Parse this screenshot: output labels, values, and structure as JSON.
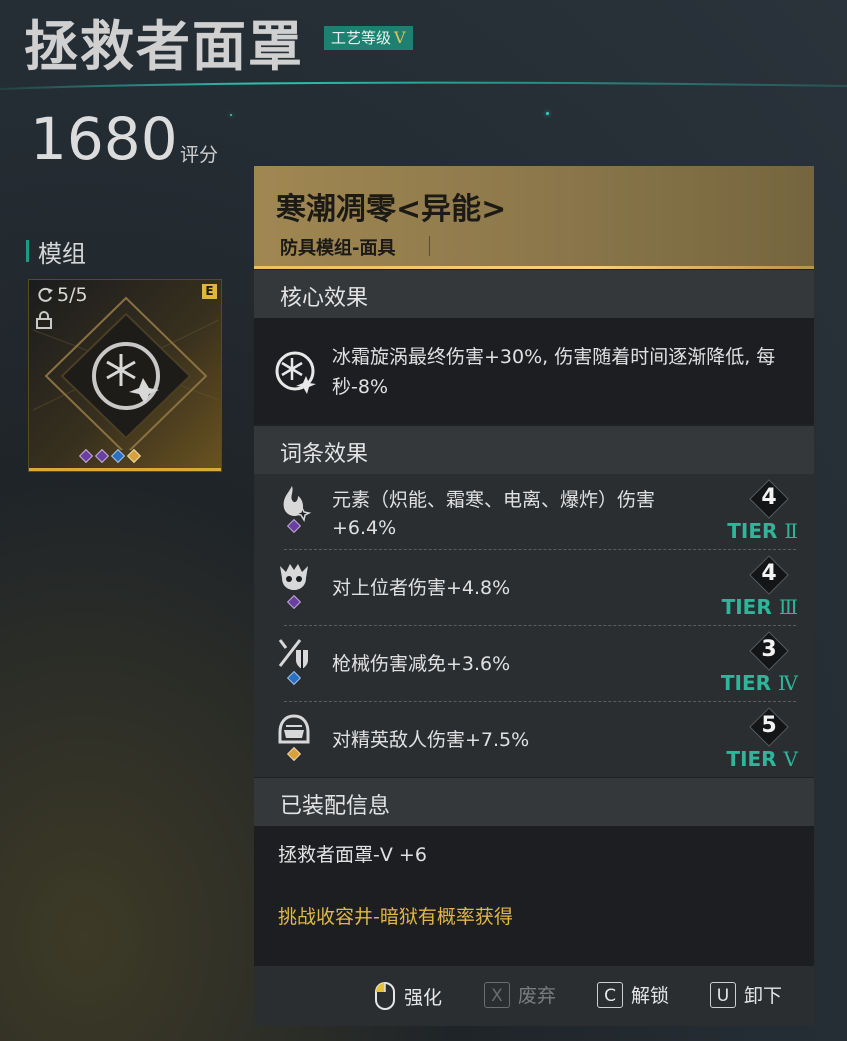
{
  "header": {
    "title": "拯救者面罩",
    "craft_label": "工艺等级",
    "craft_level": "V",
    "score_value": "1680",
    "score_unit": "评分"
  },
  "module_section": {
    "label": "模组",
    "card": {
      "count": "5/5",
      "rarity_badge": "E",
      "gems": [
        "#6b3fa0",
        "#6b3fa0",
        "#2a6fc0",
        "#d8a23a"
      ]
    }
  },
  "panel": {
    "item_name": "寒潮凋零<异能>",
    "item_type": "防具模组-面具",
    "core_header": "核心效果",
    "core_effect": "冰霜旋涡最终伤害+30%, 伤害随着时间逐渐降低, 每秒-8%",
    "affix_header": "词条效果",
    "affixes": [
      {
        "text": "元素（炽能、霜寒、电离、爆炸）伤害+6.4%",
        "rank": "4",
        "tier_prefix": "TIER",
        "tier_roman": "Ⅱ",
        "gem_color": "#6b3fa0",
        "icon": "element-flame-icon"
      },
      {
        "text": "对上位者伤害+4.8%",
        "rank": "4",
        "tier_prefix": "TIER",
        "tier_roman": "Ⅲ",
        "gem_color": "#6b3fa0",
        "icon": "boss-skull-icon"
      },
      {
        "text": "枪械伤害减免+3.6%",
        "rank": "3",
        "tier_prefix": "TIER",
        "tier_roman": "Ⅳ",
        "gem_color": "#2a6fc0",
        "icon": "gun-shield-icon"
      },
      {
        "text": "对精英敌人伤害+7.5%",
        "rank": "5",
        "tier_prefix": "TIER",
        "tier_roman": "Ⅴ",
        "gem_color": "#d8a23a",
        "icon": "elite-helmet-icon"
      }
    ],
    "equip_header": "已装配信息",
    "equip_name": "拯救者面罩-V +6",
    "equip_source": "挑战收容井-暗狱有概率获得"
  },
  "actions": [
    {
      "key": "mouse",
      "label": "强化",
      "enabled": true
    },
    {
      "key": "X",
      "label": "废弃",
      "enabled": false
    },
    {
      "key": "C",
      "label": "解锁",
      "enabled": true
    },
    {
      "key": "U",
      "label": "卸下",
      "enabled": true
    }
  ],
  "colors": {
    "accent_teal": "#1e8070",
    "tier_green": "#2eb59a",
    "gold": "#e2b648"
  }
}
